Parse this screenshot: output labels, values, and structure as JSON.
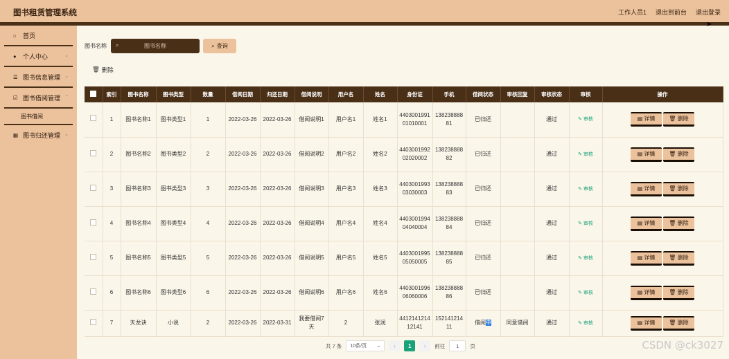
{
  "app": {
    "title": "图书租赁管理系统"
  },
  "header": {
    "links": [
      "工作人员1",
      "退出到前台",
      "退出登录"
    ]
  },
  "sidebar": {
    "home": "首页",
    "personal": "个人中心",
    "book_info": "图书信息管理",
    "borrow_mgmt": "图书借阅管理",
    "borrow_sub": "图书借阅",
    "return_mgmt": "图书归还管理"
  },
  "search": {
    "label": "图书名称",
    "placeholder": "图书名称",
    "query_label": "查询"
  },
  "toolbar": {
    "delete_label": "删除"
  },
  "table": {
    "headers": [
      "索引",
      "图书名称",
      "图书类型",
      "数量",
      "借阅日期",
      "归还日期",
      "借阅说明",
      "用户名",
      "姓名",
      "身份证",
      "手机",
      "借阅状态",
      "审核回复",
      "审核状态",
      "审核",
      "操作"
    ],
    "audit_label": "审核",
    "detail_label": "详情",
    "delete_label": "删除",
    "rows": [
      [
        "1",
        "图书名称1",
        "图书类型1",
        "1",
        "2022-03-26",
        "2022-03-26",
        "借阅说明1",
        "用户名1",
        "姓名1",
        "440300199101010001",
        "13823888881",
        "已归还",
        "",
        "通过"
      ],
      [
        "2",
        "图书名称2",
        "图书类型2",
        "2",
        "2022-03-26",
        "2022-03-26",
        "借阅说明2",
        "用户名2",
        "姓名2",
        "440300199202020002",
        "13823888882",
        "已归还",
        "",
        "通过"
      ],
      [
        "3",
        "图书名称3",
        "图书类型3",
        "3",
        "2022-03-26",
        "2022-03-26",
        "借阅说明3",
        "用户名3",
        "姓名3",
        "440300199303030003",
        "13823888883",
        "已归还",
        "",
        "通过"
      ],
      [
        "4",
        "图书名称4",
        "图书类型4",
        "4",
        "2022-03-26",
        "2022-03-26",
        "借阅说明4",
        "用户名4",
        "姓名4",
        "440300199404040004",
        "13823888884",
        "已归还",
        "",
        "通过"
      ],
      [
        "5",
        "图书名称5",
        "图书类型5",
        "5",
        "2022-03-26",
        "2022-03-26",
        "借阅说明5",
        "用户名5",
        "姓名5",
        "440300199505050005",
        "13823888885",
        "已归还",
        "",
        "通过"
      ],
      [
        "6",
        "图书名称6",
        "图书类型6",
        "6",
        "2022-03-26",
        "2022-03-26",
        "借阅说明6",
        "用户名6",
        "姓名6",
        "440300199606060006",
        "13823888886",
        "已归还",
        "",
        "通过"
      ],
      [
        "7",
        "天龙诀",
        "小说",
        "2",
        "2022-03-26",
        "2022-03-31",
        "我要借阅7天",
        "2",
        "张润",
        "441214121412141",
        "15214121411",
        "借阅中",
        "同意借阅",
        "通过"
      ]
    ]
  },
  "pager": {
    "total": "共 7 条",
    "page_size": "10条/页",
    "current": "1",
    "goto_label": "前往",
    "goto_value": "1",
    "page_unit": "页"
  },
  "watermark": "CSDN @ck3027"
}
